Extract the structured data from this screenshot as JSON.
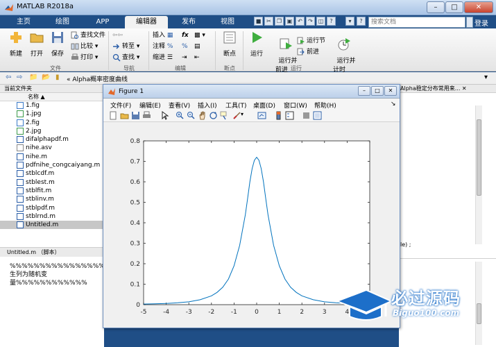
{
  "window": {
    "title": "MATLAB R2018a"
  },
  "tabs": [
    {
      "label": "主页"
    },
    {
      "label": "绘图"
    },
    {
      "label": "APP"
    },
    {
      "label": "编辑器"
    },
    {
      "label": "发布"
    },
    {
      "label": "视图"
    }
  ],
  "search": {
    "placeholder": "搜索文档",
    "login": "登录"
  },
  "ribbon": {
    "file": {
      "new": "新建",
      "open": "打开",
      "save": "保存",
      "find_files": "查找文件",
      "compare": "比较",
      "print": "打印",
      "group": "文件"
    },
    "nav": {
      "goto": "转至",
      "find": "查找",
      "group": "导航"
    },
    "edit": {
      "insert": "插入",
      "comment": "注释",
      "indent": "缩进",
      "fx": "fx",
      "group": "编辑"
    },
    "breakpoints": {
      "label": "断点",
      "group": "断点"
    },
    "run": {
      "run": "运行",
      "run_advance": "运行并\n前进",
      "run_section": "运行节",
      "advance": "前进",
      "run_time": "运行并\n计时",
      "group": "运行"
    }
  },
  "address": {
    "path": "Alpha概率密度曲线"
  },
  "folder": {
    "header": "当前文件夹",
    "col_name": "名称",
    "files": [
      {
        "name": "1.fig",
        "type": "fig"
      },
      {
        "name": "1.jpg",
        "type": "jpg"
      },
      {
        "name": "2.fig",
        "type": "fig"
      },
      {
        "name": "2.jpg",
        "type": "jpg"
      },
      {
        "name": "difalphapdf.m",
        "type": "m"
      },
      {
        "name": "nihe.asv",
        "type": "asv"
      },
      {
        "name": "nihe.m",
        "type": "m"
      },
      {
        "name": "pdfnihe_congcaiyang.m",
        "type": "m"
      },
      {
        "name": "stblcdf.m",
        "type": "m"
      },
      {
        "name": "stblest.m",
        "type": "m"
      },
      {
        "name": "stblfit.m",
        "type": "m"
      },
      {
        "name": "stblinv.m",
        "type": "m"
      },
      {
        "name": "stblpdf.m",
        "type": "m"
      },
      {
        "name": "stblrnd.m",
        "type": "m"
      },
      {
        "name": "Untitled.m",
        "type": "m",
        "selected": true
      }
    ]
  },
  "details": {
    "header": "Untitled.m （脚本）",
    "lines": [
      "%%%%%%%%%%%%%%%%%%",
      "生列为随机变",
      "量%%%%%%%%%%%%"
    ]
  },
  "right_panel": {
    "header": "Alpha稳定分布常用来...",
    "fragment": "le) ;"
  },
  "figure": {
    "title": "Figure 1",
    "menu": [
      "文件(F)",
      "编辑(E)",
      "查看(V)",
      "插入(I)",
      "工具(T)",
      "桌面(D)",
      "窗口(W)",
      "帮助(H)"
    ]
  },
  "chart_data": {
    "type": "line",
    "title": "",
    "xlabel": "",
    "ylabel": "",
    "xlim": [
      -5,
      5
    ],
    "ylim": [
      0,
      0.8
    ],
    "xticks": [
      -5,
      -4,
      -3,
      -2,
      -1,
      0,
      1,
      2,
      3,
      4,
      5
    ],
    "yticks": [
      0,
      0.1,
      0.2,
      0.3,
      0.4,
      0.5,
      0.6,
      0.7,
      0.8
    ],
    "color": "#0072bd",
    "x": [
      -5,
      -4.5,
      -4,
      -3.5,
      -3,
      -2.5,
      -2,
      -1.75,
      -1.5,
      -1.25,
      -1,
      -0.75,
      -0.5,
      -0.4,
      -0.3,
      -0.2,
      -0.1,
      0,
      0.1,
      0.2,
      0.3,
      0.4,
      0.5,
      0.75,
      1,
      1.25,
      1.5,
      1.75,
      2,
      2.5,
      3,
      3.5,
      4,
      4.5,
      5
    ],
    "y": [
      0.003,
      0.004,
      0.006,
      0.009,
      0.014,
      0.024,
      0.043,
      0.06,
      0.085,
      0.125,
      0.19,
      0.29,
      0.44,
      0.52,
      0.6,
      0.665,
      0.705,
      0.72,
      0.705,
      0.665,
      0.6,
      0.52,
      0.44,
      0.29,
      0.19,
      0.125,
      0.085,
      0.06,
      0.043,
      0.024,
      0.014,
      0.009,
      0.006,
      0.004,
      0.003
    ],
    "grid": false
  },
  "watermark": {
    "text": "必过源码",
    "url": "Biguo100.com"
  }
}
